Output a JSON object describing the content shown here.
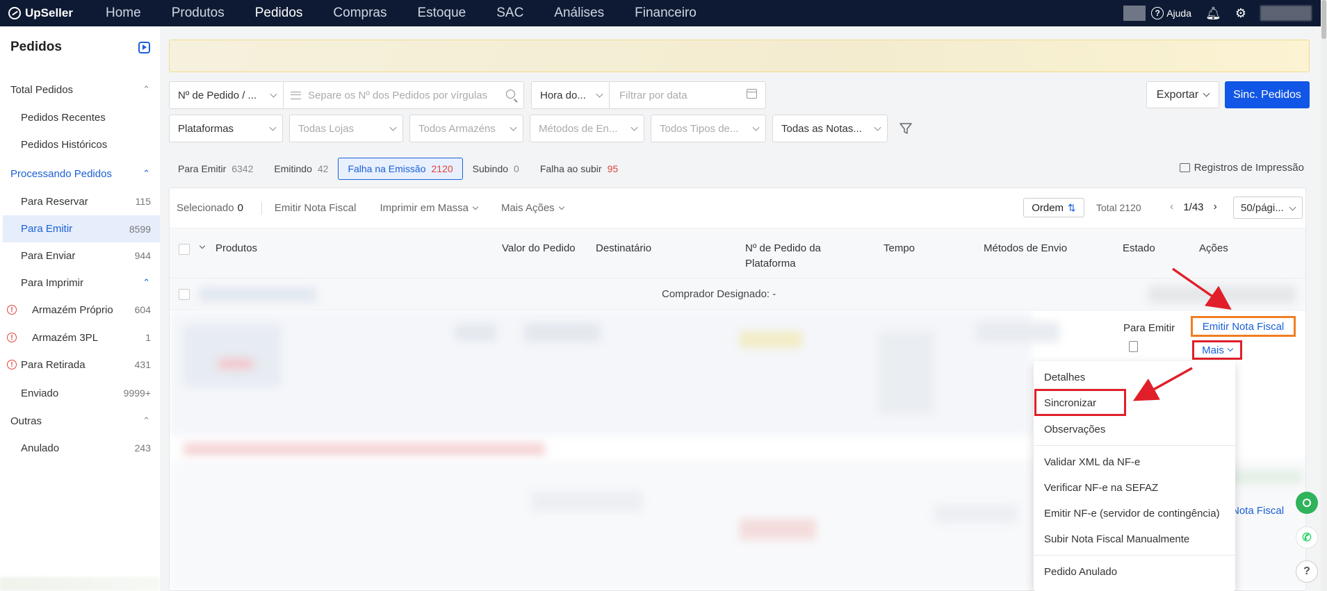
{
  "app": {
    "name": "UpSeller"
  },
  "topnav": {
    "items": [
      "Home",
      "Produtos",
      "Pedidos",
      "Compras",
      "Estoque",
      "SAC",
      "Análises",
      "Financeiro"
    ],
    "help_label": "Ajuda"
  },
  "sidebar": {
    "title": "Pedidos",
    "groups": {
      "total": "Total Pedidos",
      "processing": "Processando Pedidos",
      "print": "Para Imprimir",
      "others": "Outras"
    },
    "items": {
      "recent": "Pedidos Recentes",
      "history": "Pedidos Históricos",
      "reserve": {
        "label": "Para Reservar",
        "count": "115"
      },
      "emit": {
        "label": "Para Emitir",
        "count": "8599"
      },
      "send": {
        "label": "Para Enviar",
        "count": "944"
      },
      "own_wh": {
        "label": "Armazém Próprio",
        "count": "604"
      },
      "wh_3pl": {
        "label": "Armazém 3PL",
        "count": "1"
      },
      "pickup": {
        "label": "Para Retirada",
        "count": "431"
      },
      "sent": {
        "label": "Enviado",
        "count": "9999+"
      },
      "cancelled": {
        "label": "Anulado",
        "count": "243"
      }
    }
  },
  "filters": {
    "order_no_select": "Nº de Pedido / ...",
    "search_placeholder": "Separe os Nº dos Pedidos por vírgulas",
    "time_select": "Hora do...",
    "date_placeholder": "Filtrar por data",
    "platforms": "Plataformas",
    "stores": "Todas Lojas",
    "warehouses": "Todos Armazéns",
    "shipping": "Métodos de En...",
    "types": "Todos Tipos de...",
    "invoices": "Todas as Notas..."
  },
  "actions": {
    "export": "Exportar",
    "sync": "Sinc. Pedidos"
  },
  "status_tabs": [
    {
      "label": "Para Emitir",
      "count": "6342"
    },
    {
      "label": "Emitindo",
      "count": "42"
    },
    {
      "label": "Falha na Emissão",
      "count": "2120"
    },
    {
      "label": "Subindo",
      "count": "0"
    },
    {
      "label": "Falha ao subir",
      "count": "95"
    }
  ],
  "print_log": "Registros de Impressão",
  "toolbar": {
    "selected_label": "Selecionado",
    "selected_count": "0",
    "emit_invoice": "Emitir Nota Fiscal",
    "bulk_print": "Imprimir em Massa",
    "more_actions": "Mais Ações",
    "order_label": "Ordem",
    "total": "Total 2120",
    "page": "1/43",
    "per_page": "50/pági..."
  },
  "table": {
    "headers": {
      "products": "Produtos",
      "order_value": "Valor do Pedido",
      "recipient": "Destinatário",
      "platform_order": "Nº de Pedido da Plataforma",
      "time": "Tempo",
      "shipping": "Métodos de Envio",
      "state": "Estado",
      "actions": "Ações"
    },
    "group_label": "Comprador Designado: -",
    "row": {
      "state": "Para Emitir",
      "emit_action": "Emitir Nota Fiscal",
      "more_action": "Mais",
      "emit_action_2": "Nota Fiscal"
    }
  },
  "dropdown": {
    "items": [
      "Detalhes",
      "Sincronizar",
      "Observações",
      "Validar XML da NF-e",
      "Verificar NF-e na SEFAZ",
      "Emitir NF-e (servidor de contingência)",
      "Subir Nota Fiscal Manualmente",
      "Pedido Anulado"
    ]
  },
  "colors": {
    "nav_bg": "#0e1a33",
    "primary": "#1156e6",
    "highlight_orange": "#f07e23",
    "highlight_red": "#e01f2a",
    "error_red": "#e0433a"
  }
}
